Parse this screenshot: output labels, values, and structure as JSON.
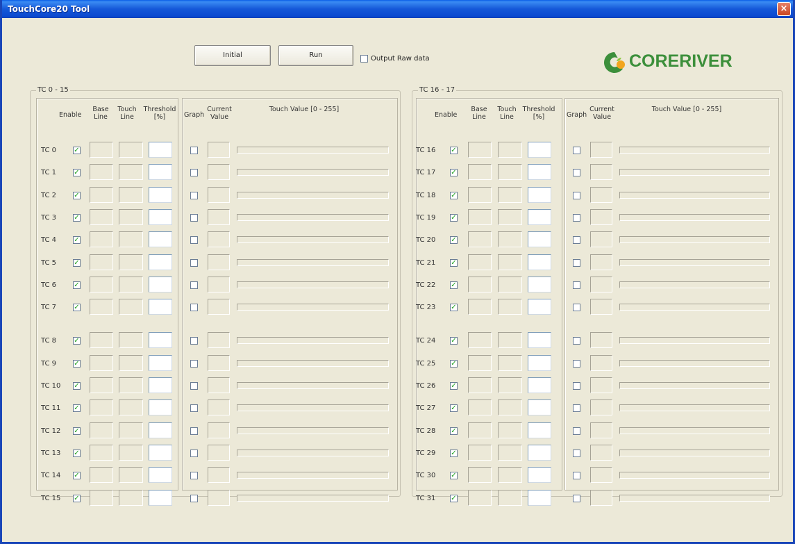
{
  "window": {
    "title": "TouchCore20 Tool",
    "close_glyph": "×"
  },
  "toolbar": {
    "initial_label": "Initial",
    "run_label": "Run",
    "output_raw_label": "Output Raw data",
    "output_raw_checked": false
  },
  "logo": {
    "text": "CORERIVER",
    "icon": "coreriver-logo-icon",
    "color": "#3c8f3b"
  },
  "groups": [
    {
      "title": "TC 0 - 15",
      "headers": {
        "enable": "Enable",
        "base_line": "Base Line",
        "touch_line": "Touch Line",
        "threshold": "Threshold [%]",
        "graph": "Graph",
        "current_value": "Current Value",
        "touch_value": "Touch Value [0 - 255]"
      },
      "channels": [
        {
          "label": "TC 0",
          "enabled": true,
          "graph": false
        },
        {
          "label": "TC 1",
          "enabled": true,
          "graph": false
        },
        {
          "label": "TC 2",
          "enabled": true,
          "graph": false
        },
        {
          "label": "TC 3",
          "enabled": true,
          "graph": false
        },
        {
          "label": "TC 4",
          "enabled": true,
          "graph": false
        },
        {
          "label": "TC 5",
          "enabled": true,
          "graph": false
        },
        {
          "label": "TC 6",
          "enabled": true,
          "graph": false
        },
        {
          "label": "TC 7",
          "enabled": true,
          "graph": false
        },
        {
          "label": "TC 8",
          "enabled": true,
          "graph": false
        },
        {
          "label": "TC 9",
          "enabled": true,
          "graph": false
        },
        {
          "label": "TC 10",
          "enabled": true,
          "graph": false
        },
        {
          "label": "TC 11",
          "enabled": true,
          "graph": false
        },
        {
          "label": "TC 12",
          "enabled": true,
          "graph": false
        },
        {
          "label": "TC 13",
          "enabled": true,
          "graph": false
        },
        {
          "label": "TC 14",
          "enabled": true,
          "graph": false
        },
        {
          "label": "TC 15",
          "enabled": true,
          "graph": false
        }
      ]
    },
    {
      "title": "TC 16 - 17",
      "headers": {
        "enable": "Enable",
        "base_line": "Base Line",
        "touch_line": "Touch Line",
        "threshold": "Threshold [%]",
        "graph": "Graph",
        "current_value": "Current Value",
        "touch_value": "Touch Value [0 - 255]"
      },
      "channels": [
        {
          "label": "TC 16",
          "enabled": true,
          "graph": false
        },
        {
          "label": "TC 17",
          "enabled": true,
          "graph": false
        },
        {
          "label": "TC 18",
          "enabled": true,
          "graph": false
        },
        {
          "label": "TC 19",
          "enabled": true,
          "graph": false
        },
        {
          "label": "TC 20",
          "enabled": true,
          "graph": false
        },
        {
          "label": "TC 21",
          "enabled": true,
          "graph": false
        },
        {
          "label": "TC 22",
          "enabled": true,
          "graph": false
        },
        {
          "label": "TC 23",
          "enabled": true,
          "graph": false
        },
        {
          "label": "TC 24",
          "enabled": true,
          "graph": false
        },
        {
          "label": "TC 25",
          "enabled": true,
          "graph": false
        },
        {
          "label": "TC 26",
          "enabled": true,
          "graph": false
        },
        {
          "label": "TC 27",
          "enabled": true,
          "graph": false
        },
        {
          "label": "TC 28",
          "enabled": true,
          "graph": false
        },
        {
          "label": "TC 29",
          "enabled": true,
          "graph": false
        },
        {
          "label": "TC 30",
          "enabled": true,
          "graph": false
        },
        {
          "label": "TC 31",
          "enabled": true,
          "graph": false
        }
      ]
    }
  ],
  "check_glyph": "✓"
}
